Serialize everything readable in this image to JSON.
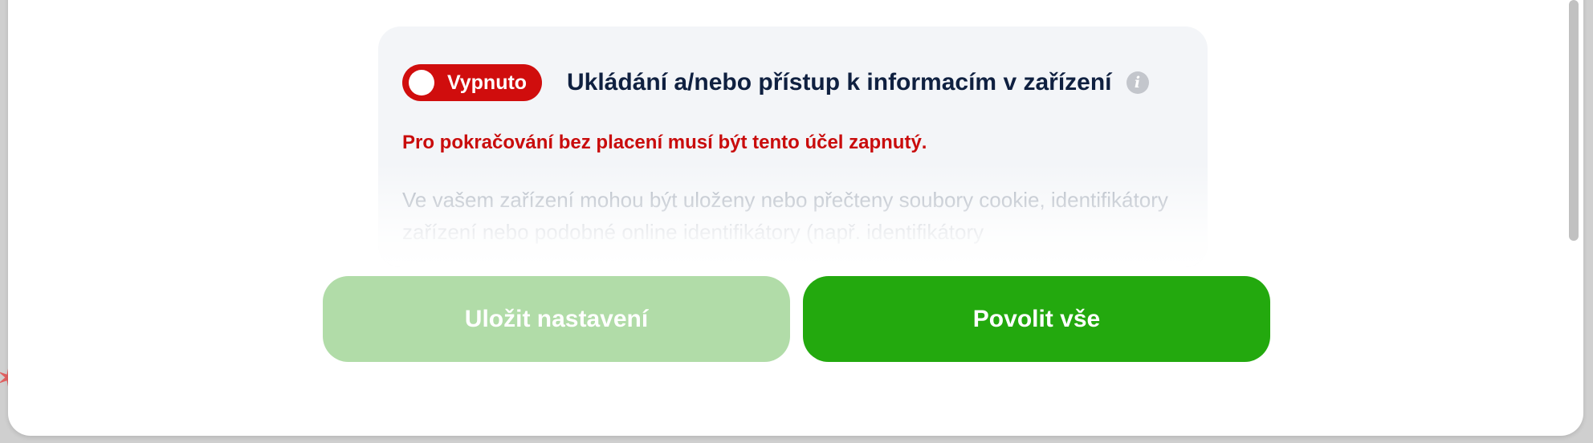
{
  "purpose": {
    "toggle_label": "Vypnuto",
    "title": "Ukládání a/nebo přístup k informacím v zařízení",
    "warning": "Pro pokračování bez placení musí být tento účel zapnutý.",
    "description": "Ve vašem zařízení mohou být uloženy nebo přečteny soubory cookie, identifikátory zařízení nebo podobné online identifikátory (např. identifikátory"
  },
  "actions": {
    "save_label": "Uložit nastavení",
    "allow_all_label": "Povolit vše"
  },
  "icons": {
    "info": "info-icon"
  },
  "colors": {
    "toggle_off": "#d00d0d",
    "warning_text": "#c90c0c",
    "save_button": "#b1dca8",
    "allow_button": "#23a90e",
    "title_text": "#0f2040"
  }
}
